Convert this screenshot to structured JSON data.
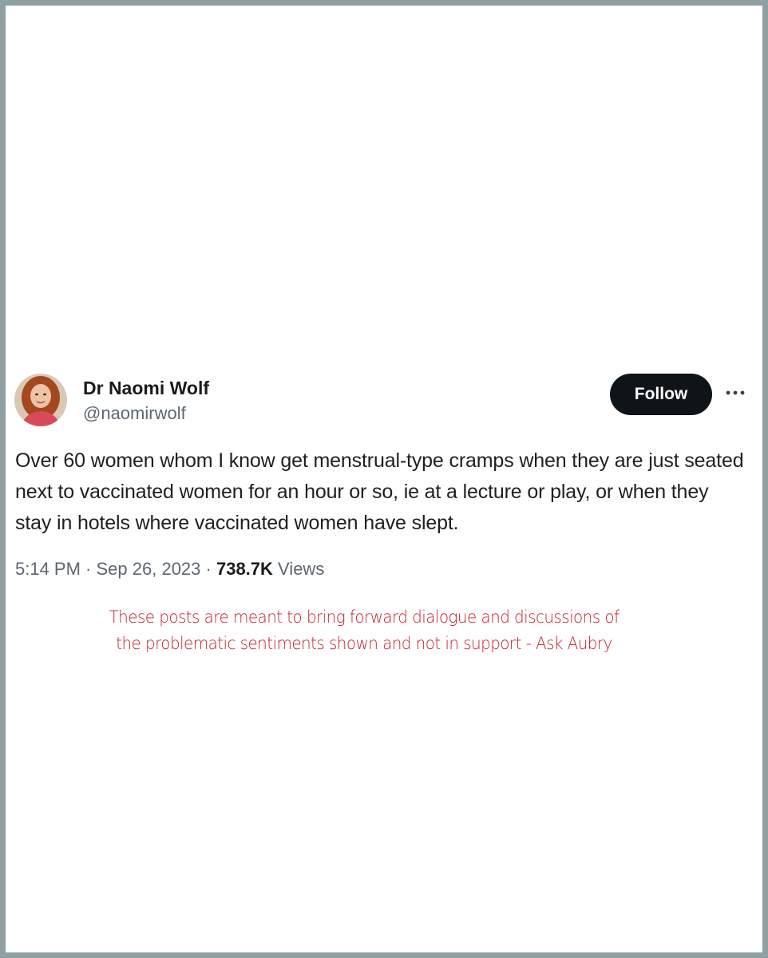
{
  "tweet": {
    "display_name": "Dr Naomi Wolf",
    "handle": "@naomirwolf",
    "follow_label": "Follow",
    "more_icon": "more-horizontal-icon",
    "text": "Over 60 women whom I know get menstrual-type cramps when they are just seated next to vaccinated women for an hour or so, ie at a lecture or play, or when they stay in hotels where vaccinated women have slept.",
    "time": "5:14 PM",
    "separator": " · ",
    "date": "Sep 26, 2023",
    "views_count": "738.7K",
    "views_label": " Views"
  },
  "disclaimer": {
    "line1": "These posts are meant to bring forward dialogue and discussions of",
    "line2": "the problematic sentiments shown and not in support - Ask Aubry"
  },
  "colors": {
    "frame_border": "#8ea0a2",
    "follow_button_bg": "#0f1419",
    "disclaimer_text": "#c8202c",
    "secondary_text": "#5d6670"
  }
}
